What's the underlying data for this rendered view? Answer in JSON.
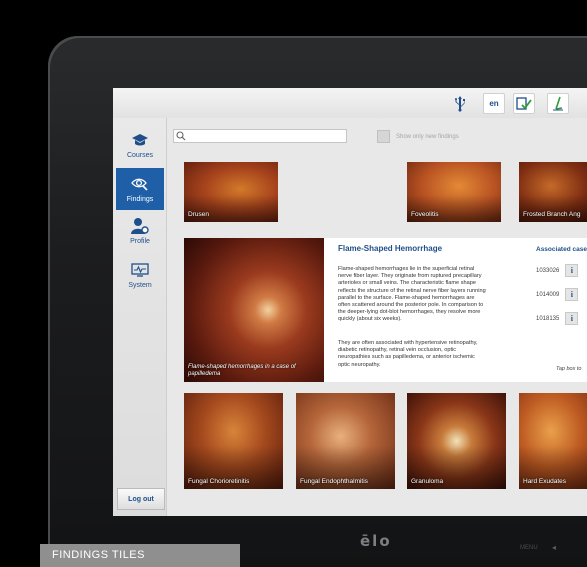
{
  "topbar": {
    "usb_icon": "usb-icon",
    "language": "en",
    "check_icon": "document-check-icon",
    "sign_icon": "signature-icon"
  },
  "sidebar": {
    "items": [
      {
        "label": "Courses",
        "icon": "graduation-cap-icon"
      },
      {
        "label": "Findings",
        "icon": "eye-search-icon"
      },
      {
        "label": "Profile",
        "icon": "user-gear-icon"
      },
      {
        "label": "System",
        "icon": "monitor-pulse-icon"
      }
    ],
    "logout": "Log out"
  },
  "search": {
    "placeholder": ""
  },
  "filter": {
    "label": "Show only new findings"
  },
  "top_tiles": [
    "Drusen",
    "Foveolitis",
    "Frosted Branch Ang"
  ],
  "detail": {
    "title": "Flame-Shaped Hemorrhage",
    "paragraph1": "Flame-shaped hemorrhages lie in the superficial retinal nerve fiber layer. They originate from ruptured precapillary arterioles or small veins. The characteristic flame shape reflects the structure of the retinal nerve fiber layers running parallel to the surface. Flame-shaped hemorrhages are often scattered around the posterior pole. In comparison to the deeper-lying dot-blot hemorrhages, they resolve more quickly (about six weeks).",
    "paragraph2": "They are often associated with hypertensive retinopathy, diabetic retinopathy, retinal vein occlusion, optic neuropathies such as papilledema, or anterior ischemic optic neuropathy.",
    "image_caption": "Flame-shaped hemorrhages in a case of papilledema",
    "associated_title": "Associated case",
    "cases": [
      "1033026",
      "1014009",
      "1018135"
    ],
    "info_label": "i",
    "tap_hint": "Tap box to"
  },
  "bottom_tiles": [
    "Fungal Chorioretinitis",
    "Fungal Endophthalmitis",
    "Granuloma",
    "Hard Exudates"
  ],
  "bezel": {
    "brand": "ēlo"
  },
  "caption": "FINDINGS TILES"
}
